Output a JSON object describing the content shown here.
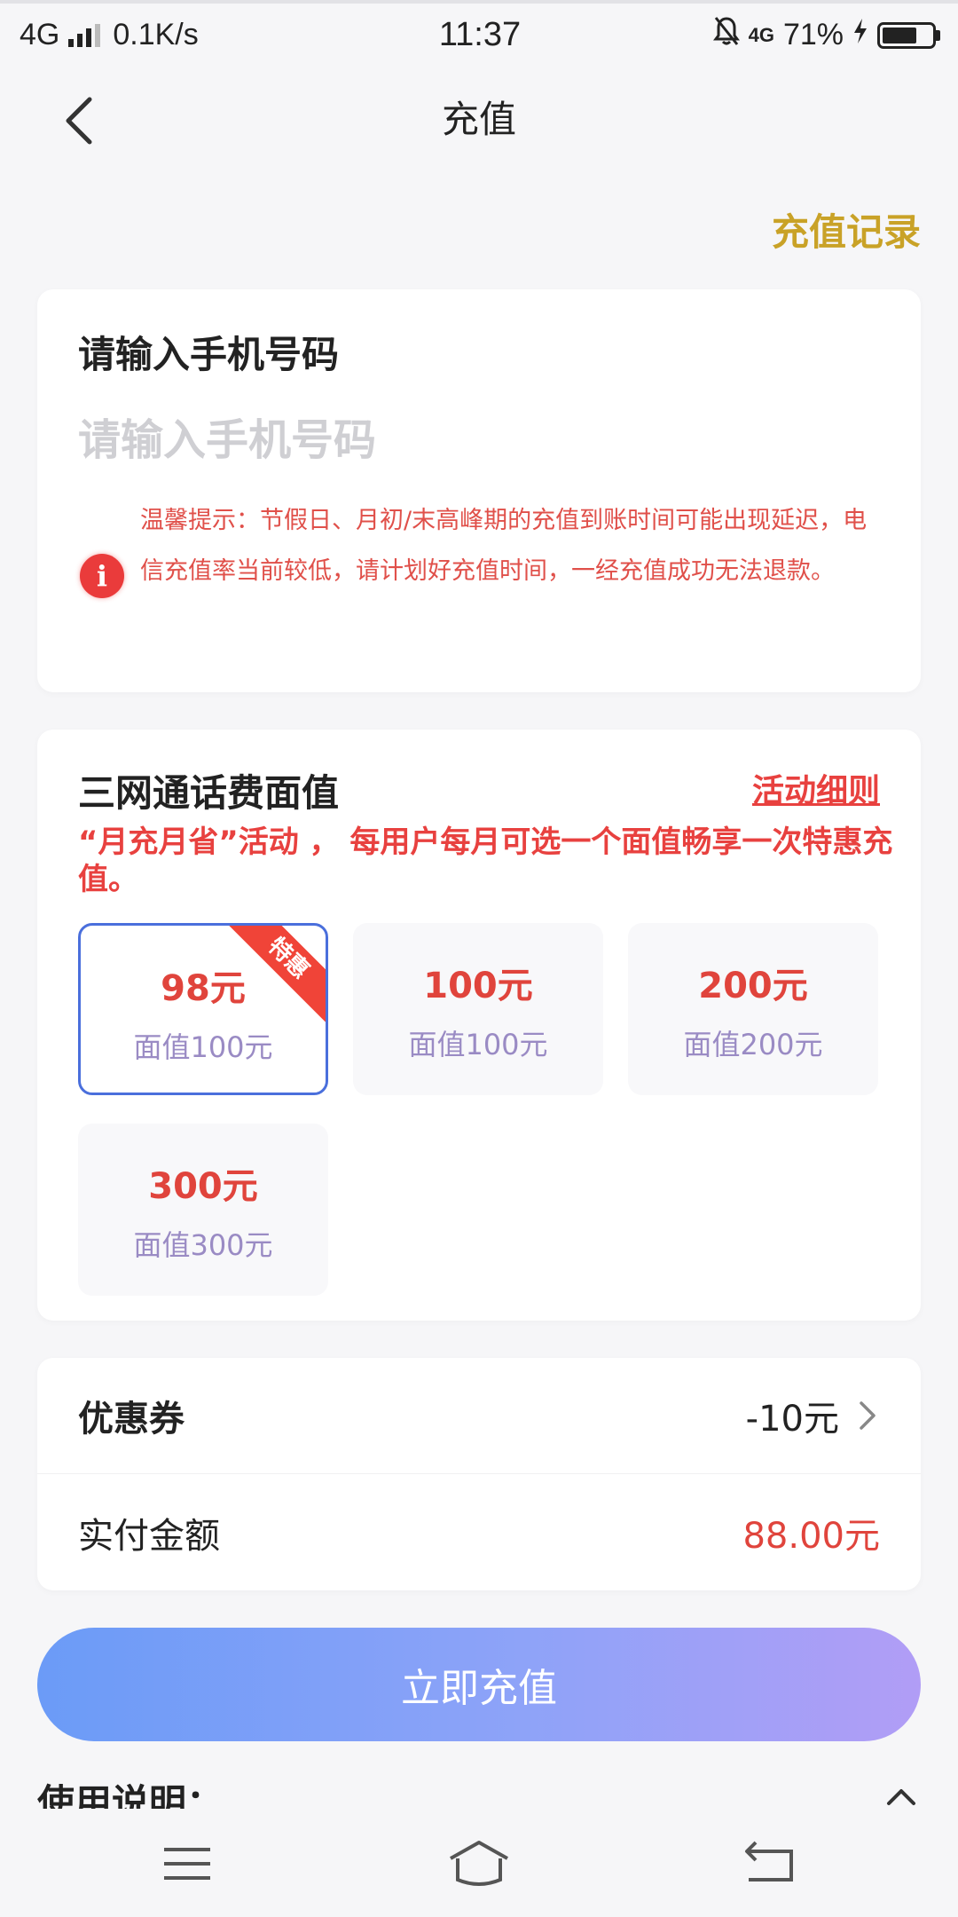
{
  "status_bar": {
    "network": "4G",
    "speed": "0.1K/s",
    "time": "11:37",
    "mobile_data_badge": "4G",
    "battery_percent": "71%",
    "battery_level": 0.71
  },
  "nav": {
    "title": "充值",
    "records_link": "充值记录"
  },
  "phone_card": {
    "label": "请输入手机号码",
    "input_value": "",
    "input_placeholder": "请输入手机号码",
    "notice": "温馨提示：节假日、月初/末高峰期的充值到账时间可能出现延迟，电信充值率当前较低，请计划好充值时间，一经充值成功无法退款。"
  },
  "denomination_card": {
    "title": "三网通话费面值",
    "rules_link": "活动细则",
    "promo": "“月充月省”活动 ， 每用户每月可选一个面值畅享一次特惠充值。",
    "items": [
      {
        "price": "98元",
        "face": "面值100元",
        "badge": "特惠",
        "selected": true
      },
      {
        "price": "100元",
        "face": "面值100元",
        "badge": "",
        "selected": false
      },
      {
        "price": "200元",
        "face": "面值200元",
        "badge": "",
        "selected": false
      },
      {
        "price": "300元",
        "face": "面值300元",
        "badge": "",
        "selected": false
      }
    ]
  },
  "payment_card": {
    "coupon_label": "优惠券",
    "coupon_value": "-10元",
    "actual_label": "实付金额",
    "actual_value": "88.00元"
  },
  "submit_button": "立即充值",
  "usage_title": "使用说明：",
  "colors": {
    "accent_gold": "#c9a227",
    "price_red": "#e0443c",
    "selected_border": "#4a6fdc",
    "button_gradient_start": "#6b9bf7",
    "button_gradient_end": "#b19df6"
  }
}
